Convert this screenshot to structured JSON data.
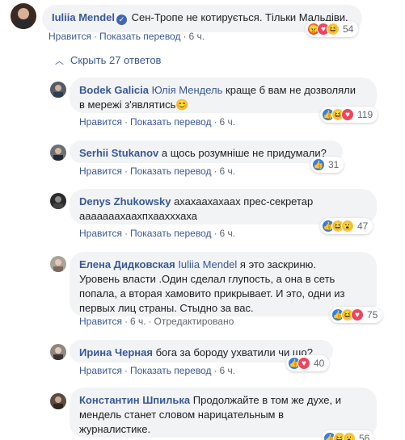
{
  "actions": {
    "like": "Нравится",
    "translate": "Показать перевод",
    "sep": "·"
  },
  "hide_replies": "Скрыть 27 ответов",
  "top_comment": {
    "author": "Iuliia Mendel",
    "text": "Сен-Тропе не котирується. Тільки Мальдіви.",
    "time": "6 ч.",
    "reaction_count": "54"
  },
  "replies": [
    {
      "author": "Bodek Galicia",
      "mention": "Юлія Мендель",
      "text_line1": " краще б вам не дозволяли",
      "text_line2": "в мережі з'являтись",
      "emoji": "😊",
      "time": "6 ч.",
      "reaction_count": "119"
    },
    {
      "author": "Serhii Stukanov",
      "text": "а щось розумніше не придумали?",
      "time": "6 ч.",
      "reaction_count": "31"
    },
    {
      "author": "Denys Zhukowsky",
      "text_line1": "ахахаахахаах прес-секретар",
      "text_line2": "ааааааахаахпхаахххаха",
      "time": "6 ч.",
      "reaction_count": "47"
    },
    {
      "author": "Елена Дидковская",
      "mention": "Iuliia Mendel",
      "text_line1": " я это заскриню.",
      "text_line2": "Уровень власти .Один сделал глупость, а она в сеть",
      "text_line3": "попала, а вторая хамовито прикрывает. И это, одни из",
      "text_line4": "первых лиц страны. Стыдно за вас.",
      "time": "6 ч.",
      "edited": "Отредактировано",
      "reaction_count": "75"
    },
    {
      "author": "Ирина Черная",
      "text": "бога за бороду ухватили чи що?",
      "time": "6 ч.",
      "reaction_count": "40"
    },
    {
      "author": "Константин Шпилька",
      "text_line1": "Продолжайте в том же духе, и",
      "text_line2": "мендель станет словом нарицательным в",
      "text_line3": "журналистике.",
      "reaction_count": "56"
    }
  ]
}
